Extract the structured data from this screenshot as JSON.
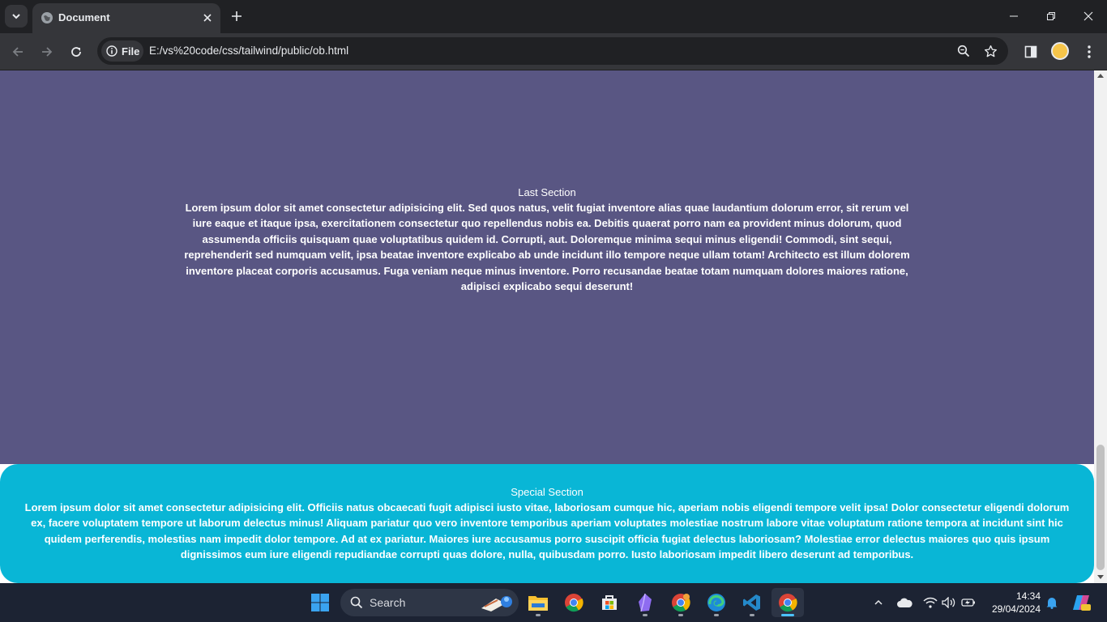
{
  "browser": {
    "tab_title": "Document",
    "site_info_label": "File",
    "url": "E:/vs%20code/css/tailwind/public/ob.html"
  },
  "page": {
    "last_section": {
      "title": "Last Section",
      "body": "Lorem ipsum dolor sit amet consectetur adipisicing elit. Sed quos natus, velit fugiat inventore alias quae laudantium dolorum error, sit rerum vel iure eaque et itaque ipsa, exercitationem consectetur quo repellendus nobis ea. Debitis quaerat porro nam ea provident minus dolorum, quod assumenda officiis quisquam quae voluptatibus quidem id. Corrupti, aut. Doloremque minima sequi minus eligendi! Commodi, sint sequi, reprehenderit sed numquam velit, ipsa beatae inventore explicabo ab unde incidunt illo tempore neque ullam totam! Architecto est illum dolorem inventore placeat corporis accusamus. Fuga veniam neque minus inventore. Porro recusandae beatae totam numquam dolores maiores ratione, adipisci explicabo sequi deserunt!",
      "background": "#595683"
    },
    "special_section": {
      "title": "Special Section",
      "body": "Lorem ipsum dolor sit amet consectetur adipisicing elit. Officiis natus obcaecati fugit adipisci iusto vitae, laboriosam cumque hic, aperiam nobis eligendi tempore velit ipsa! Dolor consectetur eligendi dolorum ex, facere voluptatem tempore ut laborum delectus minus! Aliquam pariatur quo vero inventore temporibus aperiam voluptates molestiae nostrum labore vitae voluptatum ratione tempora at incidunt sint hic quidem perferendis, molestias nam impedit dolor tempore. Ad at ex pariatur. Maiores iure accusamus porro suscipit officia fugiat delectus laboriosam? Molestiae error delectus maiores quo quis ipsum dignissimos eum iure eligendi repudiandae corrupti quas dolore, nulla, quibusdam porro. Iusto laboriosam impedit libero deserunt ad temporibus.",
      "background": "#09b6d6"
    }
  },
  "taskbar": {
    "search_label": "Search",
    "time": "14:34",
    "date": "29/04/2024",
    "apps": [
      "start-icon",
      "file-explorer-icon",
      "chrome-icon",
      "microsoft-store-icon",
      "obsidian-icon",
      "chrome-canary-icon",
      "edge-icon",
      "vscode-icon",
      "chrome-active-icon"
    ]
  }
}
